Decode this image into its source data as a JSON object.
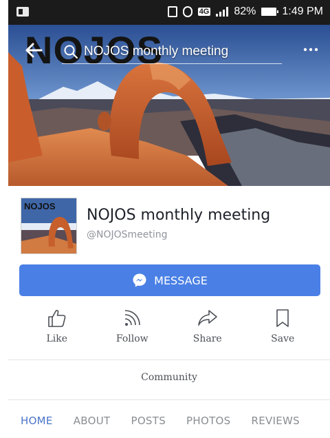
{
  "status_bar": {
    "network": "4G",
    "battery": "82%",
    "time": "1:49 PM"
  },
  "cover": {
    "wordmark": "NOJOS",
    "search_text": "NOJOS monthly meeting"
  },
  "profile": {
    "picture_label": "NOJOS",
    "name": "NOJOS monthly meeting",
    "handle": "@NOJOSmeeting"
  },
  "message_button": {
    "label": "MESSAGE"
  },
  "actions": [
    {
      "label": "Like",
      "icon": "thumbs-up-icon"
    },
    {
      "label": "Follow",
      "icon": "rss-icon"
    },
    {
      "label": "Share",
      "icon": "share-arrow-icon"
    },
    {
      "label": "Save",
      "icon": "bookmark-icon"
    }
  ],
  "community": {
    "label": "Community"
  },
  "tabs": [
    {
      "label": "HOME",
      "active": true
    },
    {
      "label": "ABOUT",
      "active": false
    },
    {
      "label": "POSTS",
      "active": false
    },
    {
      "label": "PHOTOS",
      "active": false
    },
    {
      "label": "REVIEWS",
      "active": false
    }
  ],
  "colors": {
    "accent": "#4a80e5",
    "active_tab": "#4a74c9",
    "status_bar": "#1b1b1b"
  }
}
